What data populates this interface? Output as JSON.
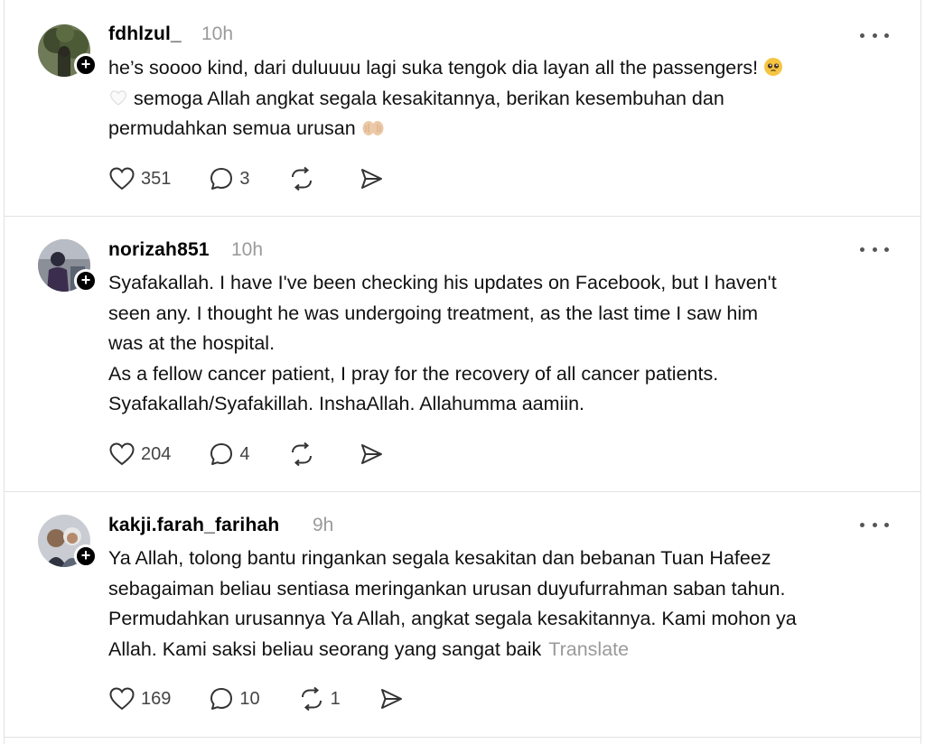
{
  "posts": [
    {
      "username": "fdhlzul_",
      "time": "10h",
      "lines": [
        "he’s soooo kind, dari duluuuu lagi suka tengok dia layan all the passengers!",
        "semoga Allah angkat segala kesakitannya, berikan kesembuhan dan",
        "permudahkan semua urusan"
      ],
      "likes": "351",
      "replies": "3",
      "reposts": ""
    },
    {
      "username": "norizah851",
      "time": "10h",
      "lines": [
        "Syafakallah. I have I've been checking his updates on Facebook, but I haven't",
        "seen any. I thought he was undergoing treatment, as the last time I saw him",
        "was at the hospital.",
        "As a fellow cancer patient, I pray for the recovery of all cancer patients.",
        "Syafakallah/Syafakillah. InshaAllah. Allahumma aamiin."
      ],
      "likes": "204",
      "replies": "4",
      "reposts": ""
    },
    {
      "username": "kakji.farah_farihah",
      "time": "9h",
      "lines": [
        "Ya Allah, tolong bantu ringankan segala kesakitan dan bebanan Tuan Hafeez",
        "sebagaiman beliau sentiasa meringankan urusan duyufurrahman saban tahun.",
        "Permudahkan urusannya Ya Allah, angkat segala kesakitannya. Kami mohon ya",
        "Allah. Kami saksi beliau seorang yang sangat baik"
      ],
      "translate": "Translate",
      "likes": "169",
      "replies": "10",
      "reposts": "1"
    }
  ],
  "icons": {
    "like": "heart-icon",
    "reply": "comment-icon",
    "repost": "repost-icon",
    "share": "send-icon",
    "more": "more-icon",
    "follow": "plus-icon"
  }
}
